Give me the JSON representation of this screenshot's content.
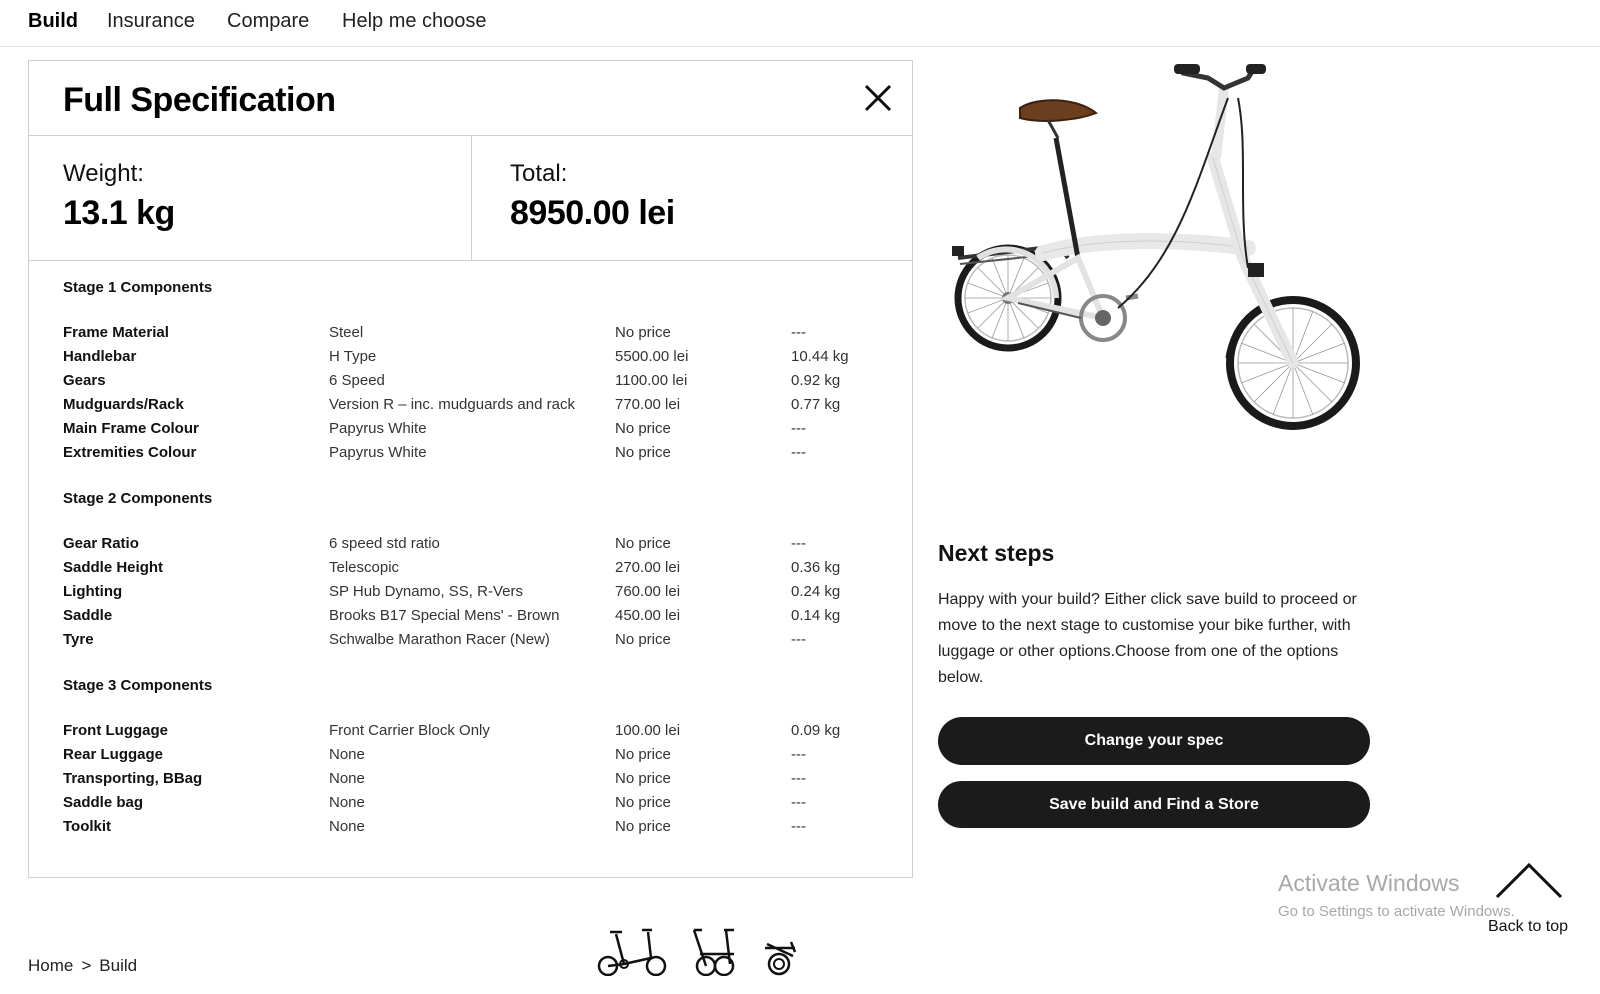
{
  "nav": {
    "tabs": [
      {
        "label": "Build",
        "active": true
      },
      {
        "label": "Insurance",
        "active": false
      },
      {
        "label": "Compare",
        "active": false
      },
      {
        "label": "Help me choose",
        "active": false
      }
    ]
  },
  "spec": {
    "title": "Full Specification",
    "close_icon": "close-icon",
    "weight_label": "Weight:",
    "weight_value": "13.1 kg",
    "total_label": "Total:",
    "total_value": "8950.00 lei",
    "stages": [
      {
        "title": "Stage 1 Components",
        "rows": [
          {
            "name": "Frame Material",
            "value": "Steel",
            "price": "No price",
            "weight": "---"
          },
          {
            "name": "Handlebar",
            "value": "H Type",
            "price": "5500.00 lei",
            "weight": "10.44 kg"
          },
          {
            "name": "Gears",
            "value": "6 Speed",
            "price": "1100.00 lei",
            "weight": "0.92 kg"
          },
          {
            "name": "Mudguards/Rack",
            "value": "Version R – inc. mudguards and rack",
            "price": "770.00 lei",
            "weight": "0.77 kg"
          },
          {
            "name": "Main Frame Colour",
            "value": "Papyrus White",
            "price": "No price",
            "weight": "---"
          },
          {
            "name": "Extremities Colour",
            "value": "Papyrus White",
            "price": "No price",
            "weight": "---"
          }
        ]
      },
      {
        "title": "Stage 2 Components",
        "rows": [
          {
            "name": "Gear Ratio",
            "value": "6 speed std ratio",
            "price": "No price",
            "weight": "---"
          },
          {
            "name": "Saddle Height",
            "value": "Telescopic",
            "price": "270.00 lei",
            "weight": "0.36 kg"
          },
          {
            "name": "Lighting",
            "value": "SP Hub Dynamo, SS, R-Vers",
            "price": "760.00 lei",
            "weight": "0.24 kg"
          },
          {
            "name": "Saddle",
            "value": "Brooks B17 Special Mens' - Brown",
            "price": "450.00 lei",
            "weight": "0.14 kg"
          },
          {
            "name": "Tyre",
            "value": "Schwalbe Marathon Racer (New)",
            "price": "No price",
            "weight": "---"
          }
        ]
      },
      {
        "title": "Stage 3 Components",
        "rows": [
          {
            "name": "Front Luggage",
            "value": "Front Carrier Block Only",
            "price": "100.00 lei",
            "weight": "0.09 kg"
          },
          {
            "name": "Rear Luggage",
            "value": "None",
            "price": "No price",
            "weight": "---"
          },
          {
            "name": "Transporting, BBag",
            "value": "None",
            "price": "No price",
            "weight": "---"
          },
          {
            "name": "Saddle bag",
            "value": "None",
            "price": "No price",
            "weight": "---"
          },
          {
            "name": "Toolkit",
            "value": "None",
            "price": "No price",
            "weight": "---"
          }
        ]
      }
    ]
  },
  "next_steps": {
    "title": "Next steps",
    "text": "Happy with your build? Either click save build to proceed or move to the next stage to customise your bike further, with luggage or other options.Choose from one of the options below.",
    "change_spec_label": "Change your spec",
    "save_build_label": "Save build and Find a Store"
  },
  "watermark": {
    "title": "Activate Windows",
    "subtitle": "Go to Settings to activate Windows."
  },
  "back_to_top": "Back to top",
  "breadcrumb": {
    "home": "Home",
    "separator": ">",
    "current": "Build"
  },
  "icons": {
    "bike_image": "folding-bike-image",
    "bike_unfolded": "bike-unfolded-icon",
    "bike_half_folded": "bike-half-folded-icon",
    "bike_folded": "bike-folded-icon",
    "back_to_top": "chevron-up-icon"
  },
  "colors": {
    "button_bg": "#1b1b1b",
    "border": "#cfcfcf",
    "watermark": "#a8a8a8"
  }
}
